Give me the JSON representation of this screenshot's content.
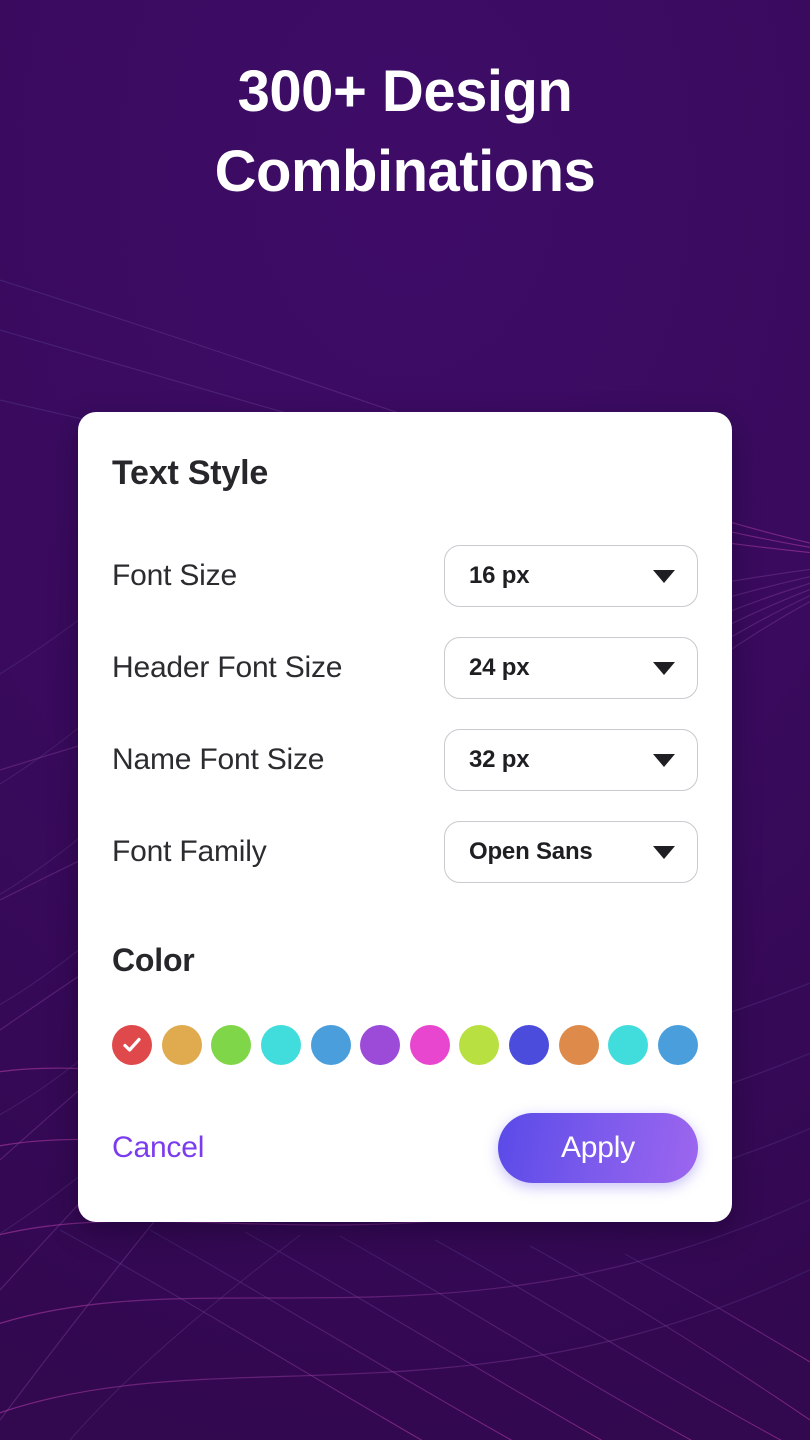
{
  "headline": {
    "line1": "300+ Design",
    "line2": "Combinations"
  },
  "card": {
    "title": "Text Style",
    "fields": [
      {
        "label": "Font Size",
        "value": "16 px",
        "name": "font-size"
      },
      {
        "label": "Header Font Size",
        "value": "24 px",
        "name": "header-font-size"
      },
      {
        "label": "Name Font Size",
        "value": "32 px",
        "name": "name-font-size"
      },
      {
        "label": "Font Family",
        "value": "Open Sans",
        "name": "font-family"
      }
    ],
    "color_section_title": "Color",
    "swatches": [
      {
        "hex": "#E0494B",
        "selected": true
      },
      {
        "hex": "#E0AA4E",
        "selected": false
      },
      {
        "hex": "#7FD648",
        "selected": false
      },
      {
        "hex": "#41DCDC",
        "selected": false
      },
      {
        "hex": "#4A9EDC",
        "selected": false
      },
      {
        "hex": "#9B4BD8",
        "selected": false
      },
      {
        "hex": "#E846CE",
        "selected": false
      },
      {
        "hex": "#B7E040",
        "selected": false
      },
      {
        "hex": "#4B4BDC",
        "selected": false
      },
      {
        "hex": "#DD8A4A",
        "selected": false
      },
      {
        "hex": "#41DCDC",
        "selected": false
      },
      {
        "hex": "#4A9EDC",
        "selected": false
      }
    ],
    "cancel_label": "Cancel",
    "apply_label": "Apply"
  },
  "theme": {
    "background": "#3A0B5F",
    "card_background": "#FFFFFF",
    "accent": "#7B3BEE",
    "apply_gradient_start": "#5A4AE8",
    "apply_gradient_end": "#9D66EF",
    "line_color": "#6B2A86"
  },
  "icons": {
    "caret": "chevron-down-icon",
    "check": "check-icon"
  }
}
